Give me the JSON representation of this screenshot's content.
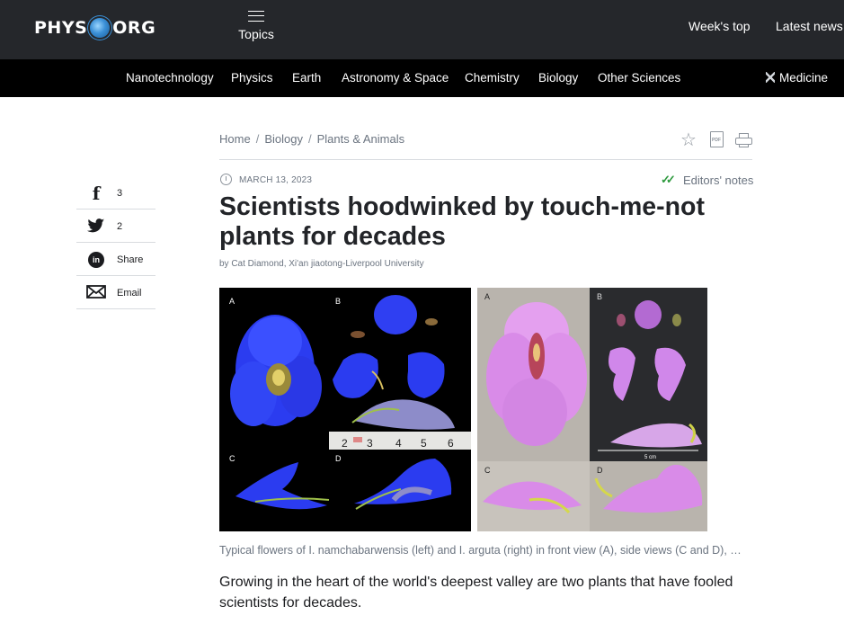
{
  "header": {
    "logo_left": "PHYS",
    "logo_right": "ORG",
    "topics_label": "Topics",
    "weeks_top": "Week's top",
    "latest_news": "Latest news"
  },
  "nav": {
    "items": [
      "Nanotechnology",
      "Physics",
      "Earth",
      "Astronomy & Space",
      "Chemistry",
      "Biology",
      "Other Sciences",
      "Medicine"
    ]
  },
  "breadcrumb": {
    "home": "Home",
    "section": "Biology",
    "subsection": "Plants & Animals",
    "separator": "/"
  },
  "article": {
    "date": "MARCH 13, 2023",
    "editors_notes": "Editors' notes",
    "title": "Scientists hoodwinked by touch-me-not plants for decades",
    "byline": "by Cat Diamond, Xi'an jiaotong-Liverpool University",
    "caption": "Typical flowers of I. namchabarwensis (left) and I. arguta (right) in front view (A), side views (C and D), …",
    "lead": "Growing in the heart of the world's deepest valley are two plants that have fooled scientists for decades."
  },
  "share": {
    "facebook_count": "3",
    "twitter_count": "2",
    "linkedin_label": "Share",
    "email_label": "Email"
  },
  "figure": {
    "left_labels": [
      "A",
      "B",
      "C",
      "D"
    ],
    "right_labels": [
      "A",
      "B",
      "C",
      "D"
    ],
    "ruler_numbers": [
      "2",
      "3",
      "4",
      "5",
      "6"
    ],
    "scale_label": "5 cm"
  },
  "colors": {
    "header_bg": "#25272b",
    "nav_bg": "#000000",
    "muted_text": "#6b7480",
    "check_green": "#2e9a3e"
  }
}
